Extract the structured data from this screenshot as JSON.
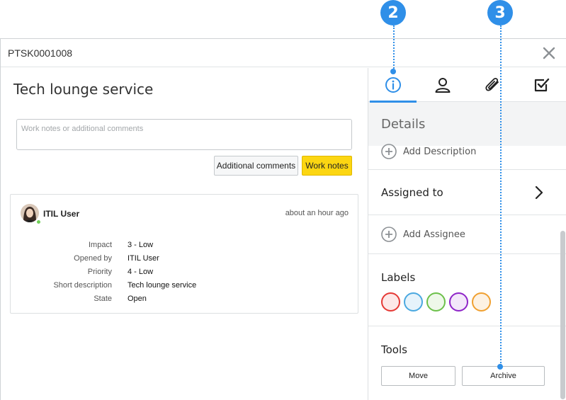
{
  "callouts": [
    {
      "number": "2"
    },
    {
      "number": "3"
    }
  ],
  "window": {
    "title": "PTSK0001008"
  },
  "record": {
    "title": "Tech lounge service",
    "notes_placeholder": "Work notes or additional comments",
    "btn_additional_comments": "Additional comments",
    "btn_work_notes": "Work notes"
  },
  "activity": {
    "user": "ITIL User",
    "timestamp": "about an hour ago",
    "fields": [
      {
        "label": "Impact",
        "value": "3 - Low"
      },
      {
        "label": "Opened by",
        "value": "ITIL User"
      },
      {
        "label": "Priority",
        "value": "4 - Low"
      },
      {
        "label": "Short description",
        "value": "Tech lounge service"
      },
      {
        "label": "State",
        "value": "Open"
      }
    ]
  },
  "sidebar": {
    "tabs": [
      {
        "icon": "info-icon",
        "active": true
      },
      {
        "icon": "user-icon",
        "active": false
      },
      {
        "icon": "paperclip-icon",
        "active": false
      },
      {
        "icon": "checkbox-icon",
        "active": false
      }
    ],
    "details_header": "Details",
    "add_description": "Add Description",
    "assigned_to": "Assigned to",
    "add_assignee": "Add Assignee",
    "labels_title": "Labels",
    "label_colors": [
      "#e53935",
      "#4aa8e0",
      "#6cc04a",
      "#8e24c8",
      "#f0a030"
    ],
    "label_fills": [
      "#fde8e8",
      "#e6f3fb",
      "#eef8e9",
      "#f3e8fa",
      "#fdf2e3"
    ],
    "tools_title": "Tools",
    "move_label": "Move",
    "archive_label": "Archive"
  },
  "colors": {
    "accent": "#2f8fe8",
    "work_notes_button": "#fcd612"
  }
}
